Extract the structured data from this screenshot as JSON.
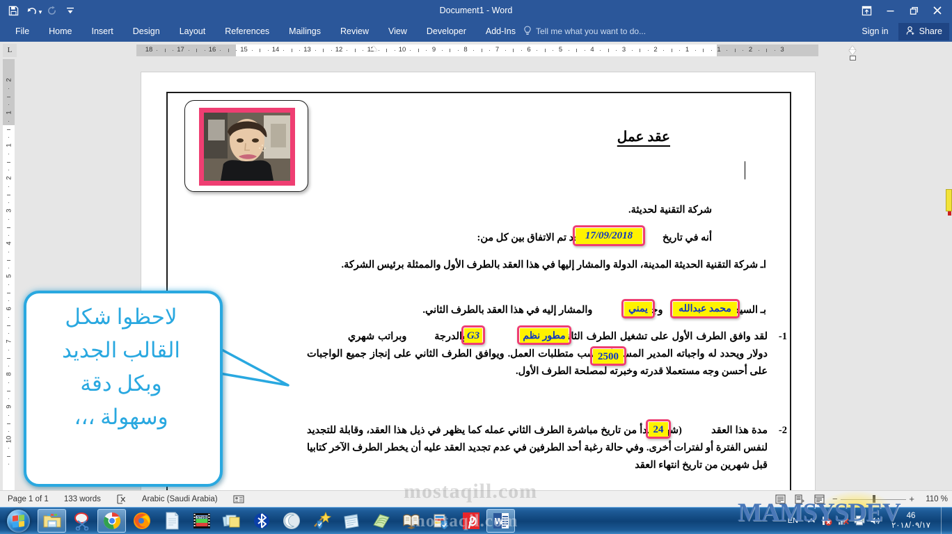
{
  "window": {
    "title": "Document1 - Word",
    "quick_access": [
      {
        "name": "save",
        "glyph": "💾"
      },
      {
        "name": "undo",
        "glyph": "↶"
      },
      {
        "name": "redo",
        "glyph": "↻"
      },
      {
        "name": "customize",
        "glyph": "☷"
      }
    ],
    "controls": {
      "ribbon_display": "⤒",
      "minimize": "—",
      "restore": "❐",
      "close": "✕"
    }
  },
  "ribbon": {
    "tabs": [
      {
        "label": "File"
      },
      {
        "label": "Home"
      },
      {
        "label": "Insert"
      },
      {
        "label": "Design"
      },
      {
        "label": "Layout"
      },
      {
        "label": "References"
      },
      {
        "label": "Mailings"
      },
      {
        "label": "Review"
      },
      {
        "label": "View"
      },
      {
        "label": "Developer"
      },
      {
        "label": "Add-Ins"
      }
    ],
    "tell_me": "Tell me what you want to do...",
    "sign_in": "Sign in",
    "share": "Share"
  },
  "ruler": {
    "tab_selector": "L",
    "horizontal_ticks": [
      18,
      17,
      16,
      15,
      14,
      13,
      12,
      11,
      10,
      9,
      8,
      7,
      6,
      5,
      4,
      3,
      2,
      1,
      1,
      2,
      3
    ],
    "vertical_ticks": [
      2,
      1,
      1,
      2,
      3,
      4,
      5,
      6,
      7,
      8,
      9,
      10
    ]
  },
  "document": {
    "title": "عقد عمل",
    "line_company": "شركة التقنية لحديثة.",
    "line_date_before": "أنه في تاريخ",
    "field_date": "17/09/2018",
    "line_date_after": "م قد تم الاتفاق بين كل من:",
    "para_a": "اـ شركة التقنية الحديثة المدينة، الدولة والمشار إليها في هذا العقد بالطرف الأول والممثلة برئيس الشركة.",
    "para_b_1": "بـ السيد",
    "field_name": "محمد عبدالله",
    "para_b_2": "وجنسيته",
    "field_nationality": "يمني",
    "para_b_3": "والمشار إليه في هذا العقد بالطرف الثاني.",
    "item1_num": "1-",
    "item1_a": "لقد وافق الطرف الأول على تشغيل الطرف الثاني بوظيفة",
    "field_job": "مطور نظم",
    "item1_b": "والدرجة",
    "field_grade": "G3",
    "item1_c": "وبراتب شهري",
    "field_salary": "2500",
    "item1_d": "دولار ويحدد له واجباته المدير المسؤول حسب متطلبات العمل.  ويوافق الطرف الثاني على إنجاز جميع الواجبات على أحسن وجه مستعملا قدرته وخبرته لمصلحة الطرف الأول.",
    "item2_num": "2-",
    "item2_a": "مدة هذا العقد",
    "field_months": "24",
    "item2_b": "(شهر) تبدأ من تاريخ مباشرة الطرف الثاني عمله كما يظهر في ذيل هذا العقد، وقابلة للتجديد لنفس الفترة أو لفترات أخرى. وفي حالة رغبة أحد الطرفين في عدم تجديد",
    "item2_c": "العقد عليه أن يخطر الطرف الآخر كتابيا قبل شهرين من تاريخ انتهاء العقد"
  },
  "callout": {
    "lines": [
      "لاحظوا شكل",
      "القالب الجديد",
      "وبكل دقة",
      "وسهولة ،،،"
    ],
    "color": "#29a8e0"
  },
  "status_bar": {
    "page": "Page 1 of 1",
    "words": "133 words",
    "language": "Arabic (Saudi Arabia)",
    "zoom": "110 %"
  },
  "taskbar": {
    "buttons": [
      {
        "name": "start"
      },
      {
        "name": "file-explorer"
      },
      {
        "name": "snipping-tool"
      },
      {
        "name": "google-chrome"
      },
      {
        "name": "mozilla-firefox"
      },
      {
        "name": "text-document"
      },
      {
        "name": "studio-video"
      },
      {
        "name": "sticky-notes"
      },
      {
        "name": "bluetooth"
      },
      {
        "name": "moon-app"
      },
      {
        "name": "wizard-shield"
      },
      {
        "name": "notepad-app"
      },
      {
        "name": "green-book"
      },
      {
        "name": "quran-book"
      },
      {
        "name": "files-shield"
      },
      {
        "name": "pinterest"
      },
      {
        "name": "microsoft-word"
      }
    ],
    "tray": {
      "language": "EN",
      "time": "46",
      "date": "٢٠١٨/٠٩/١٧"
    }
  },
  "watermarks": {
    "main": "MAMSYSDEV",
    "sub": "mostaqill.com",
    "sub2": "mostaqil.com"
  },
  "colors": {
    "word_blue": "#2b579a",
    "highlight_yellow": "#fff200",
    "box_pink": "#ef3e72",
    "callout_cyan": "#29a8e0",
    "field_text_blue": "#0b35c4"
  }
}
